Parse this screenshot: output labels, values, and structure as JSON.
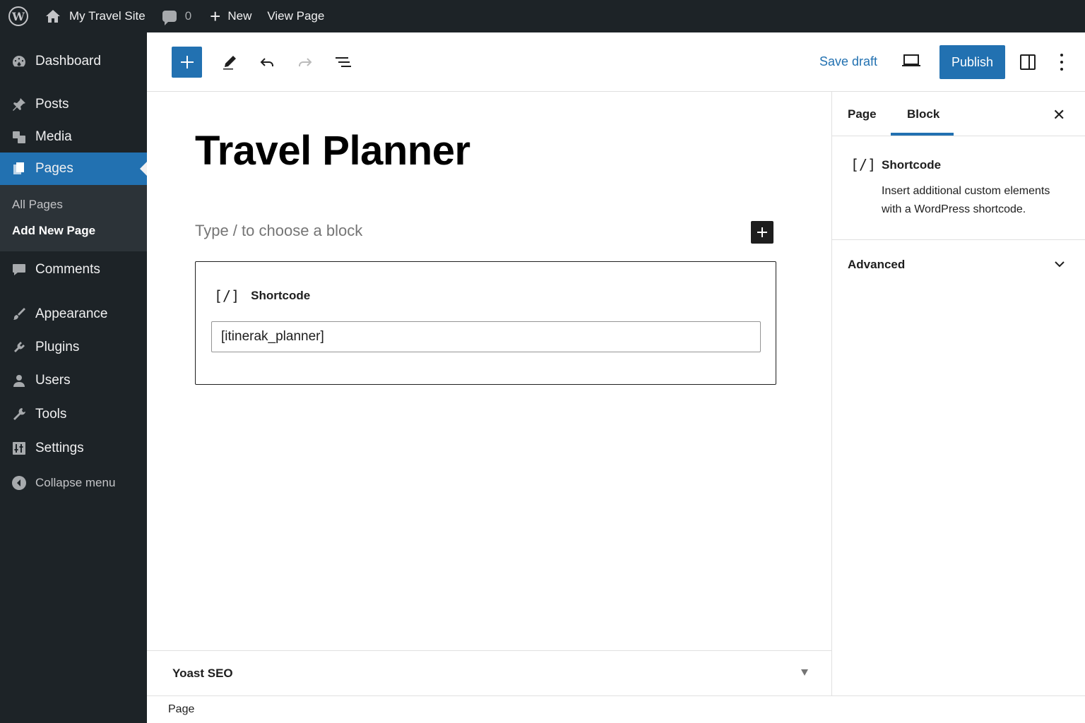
{
  "admin_bar": {
    "site_name": "My Travel Site",
    "comments_count": "0",
    "new_label": "New",
    "view_label": "View Page"
  },
  "sidebar": {
    "items": [
      {
        "label": "Dashboard",
        "icon": "dashboard-icon"
      },
      {
        "label": "Posts",
        "icon": "pin-icon"
      },
      {
        "label": "Media",
        "icon": "media-icon"
      },
      {
        "label": "Pages",
        "icon": "pages-icon",
        "current": true
      },
      {
        "label": "Comments",
        "icon": "comment-icon"
      },
      {
        "label": "Appearance",
        "icon": "brush-icon"
      },
      {
        "label": "Plugins",
        "icon": "plugin-icon"
      },
      {
        "label": "Users",
        "icon": "user-icon"
      },
      {
        "label": "Tools",
        "icon": "wrench-icon"
      },
      {
        "label": "Settings",
        "icon": "settings-icon"
      }
    ],
    "submenu": [
      "All Pages",
      "Add New Page"
    ],
    "collapse_label": "Collapse menu"
  },
  "toolbar": {
    "save_draft": "Save draft",
    "publish": "Publish"
  },
  "editor": {
    "title": "Travel Planner",
    "placeholder": "Type / to choose a block",
    "shortcode_block": {
      "icon_text": "[/]",
      "label": "Shortcode",
      "value": "[itinerak_planner]"
    }
  },
  "yoast": {
    "title": "Yoast SEO"
  },
  "footer": {
    "breadcrumb": "Page"
  },
  "settings_sidebar": {
    "tabs": [
      "Page",
      "Block"
    ],
    "active_tab": "Block",
    "block_icon_text": "[/]",
    "block_title": "Shortcode",
    "block_description": "Insert additional custom elements with a WordPress shortcode.",
    "advanced_label": "Advanced"
  },
  "colors": {
    "accent": "#2271b1",
    "admin_dark": "#1d2327"
  }
}
